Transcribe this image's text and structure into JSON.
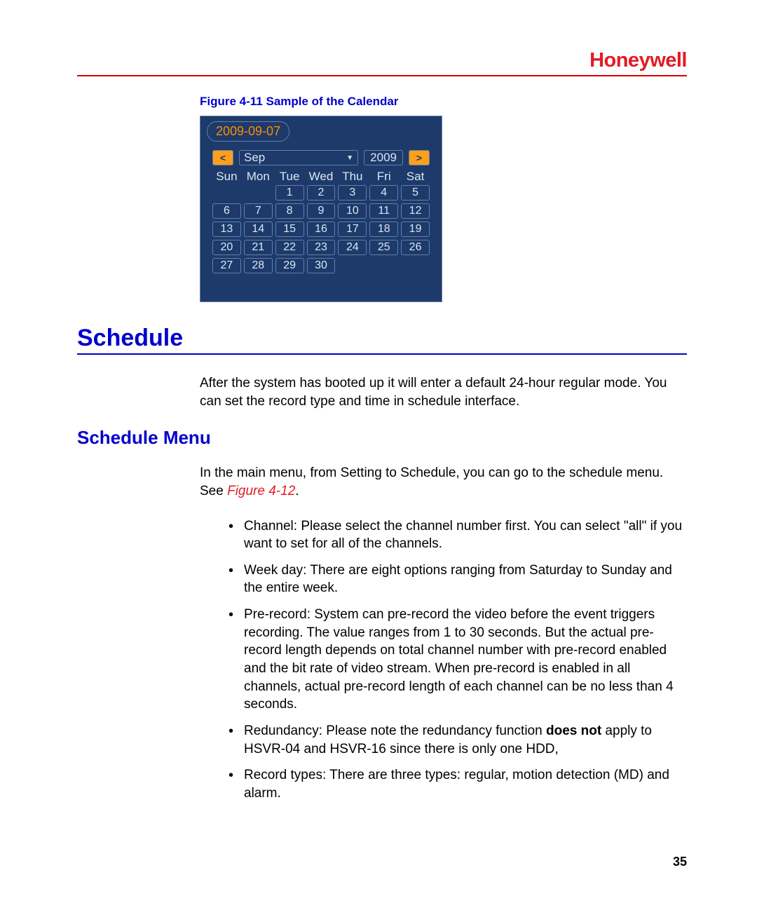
{
  "logo": "Honeywell",
  "figure_caption": "Figure 4-11 Sample of the Calendar",
  "calendar": {
    "date": "2009-09-07",
    "prev": "<",
    "month": "Sep",
    "year": "2009",
    "next": ">",
    "dow": [
      "Sun",
      "Mon",
      "Tue",
      "Wed",
      "Thu",
      "Fri",
      "Sat"
    ],
    "weeks": [
      [
        "",
        "",
        "1",
        "2",
        "3",
        "4",
        "5"
      ],
      [
        "6",
        "7",
        "8",
        "9",
        "10",
        "11",
        "12"
      ],
      [
        "13",
        "14",
        "15",
        "16",
        "17",
        "18",
        "19"
      ],
      [
        "20",
        "21",
        "22",
        "23",
        "24",
        "25",
        "26"
      ],
      [
        "27",
        "28",
        "29",
        "30",
        "",
        "",
        ""
      ]
    ]
  },
  "section_title": "Schedule",
  "intro_text": "After the system has booted up it will enter a default 24-hour regular mode. You can set the record type and time in schedule interface.",
  "sub_title": "Schedule Menu",
  "menu_intro_a": "In the main menu, from Setting to Schedule, you can go to the schedule menu. See ",
  "menu_intro_ref": "Figure 4-12",
  "menu_intro_b": ".",
  "bullets": {
    "b0": "Channel: Please select the channel number first. You can select \"all\" if you want to set for all of the channels.",
    "b1": "Week day: There are eight options ranging from Saturday to Sunday and the entire week.",
    "b2": "Pre-record: System can pre-record the video before the event triggers recording. The value ranges from 1 to 30 seconds. But the actual pre-record length depends on total channel number with pre-record enabled and the bit rate of video stream. When pre-record is enabled in all channels, actual pre-record length of each channel can be no less than 4 seconds.",
    "b3a": "Redundancy: Please note the redundancy function ",
    "b3b": "does not",
    "b3c": " apply to HSVR-04 and HSVR-16 since there is only one HDD,",
    "b4": "Record types: There are three types: regular, motion detection (MD) and alarm."
  },
  "page_number": "35"
}
